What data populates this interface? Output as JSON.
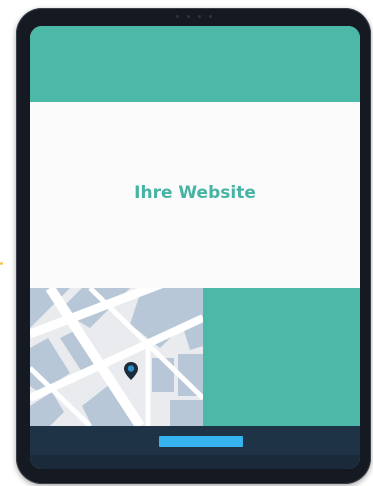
{
  "hero": {
    "title": "Ihre Website"
  },
  "colors": {
    "teal": "#4bb8a8",
    "title_teal": "#46b3a4",
    "footer_navy": "#1f3346",
    "button_blue": "#37b3f0",
    "device_frame": "#151a22",
    "map_block": "#b7c7d8",
    "map_pin": "#2a8fd0"
  },
  "icons": {
    "map_pin": "map-pin-icon"
  }
}
